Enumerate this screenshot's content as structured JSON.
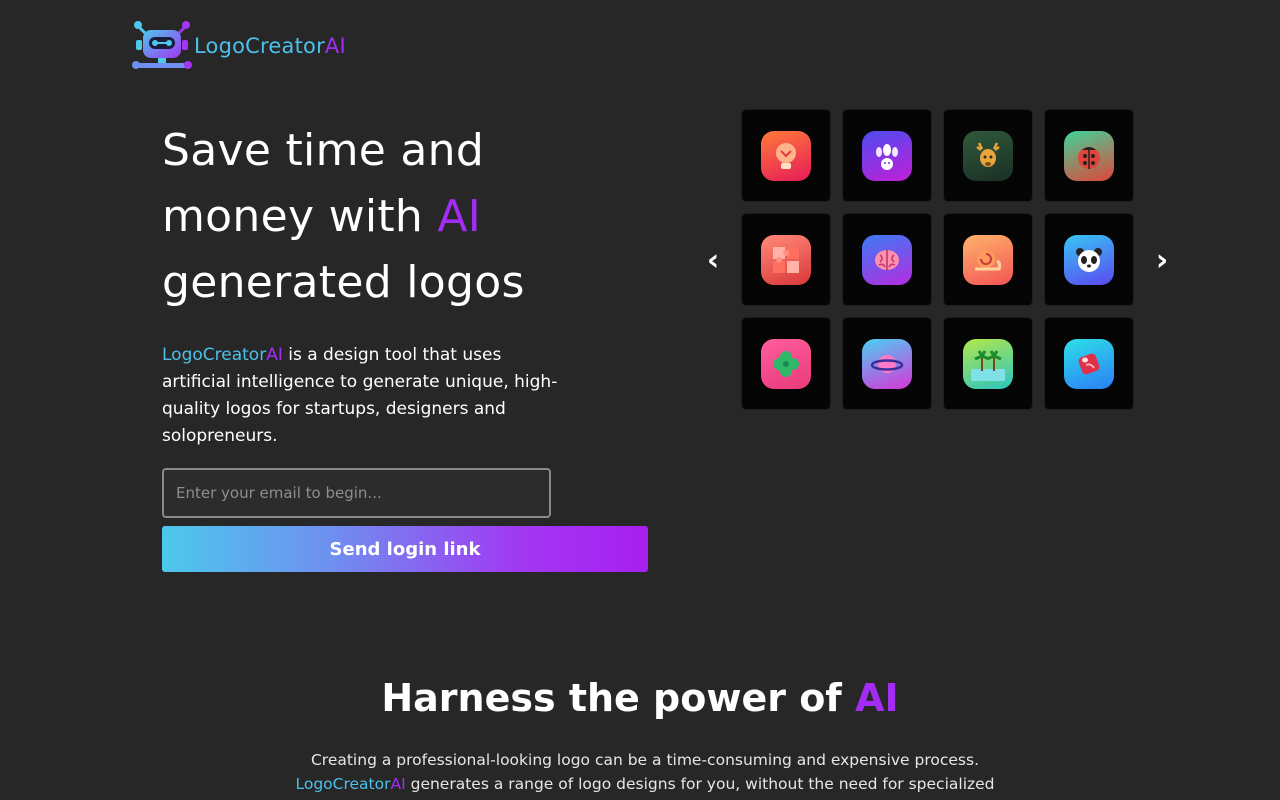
{
  "brand": {
    "name_part1": "LogoCreator",
    "name_part2": "AI",
    "logo_icon": "robot-icon"
  },
  "hero": {
    "title_line1": "Save time and",
    "title_line2_prefix": "money with ",
    "title_line2_highlight": "AI",
    "title_line3": "generated logos",
    "desc_brand1": "LogoCreator",
    "desc_brand2": "AI",
    "desc_text": " is a design tool that uses artificial intelligence to generate unique, high-quality logos for startups, designers and solopreneurs.",
    "email_placeholder": "Enter your email to begin...",
    "email_value": "",
    "cta_label": "Send login link"
  },
  "carousel": {
    "prev_label": "‹",
    "next_label": "›",
    "icons": [
      "lightbulb-icon",
      "bowling-icon",
      "deer-icon",
      "ladybug-icon",
      "puzzle-icon",
      "brain-icon",
      "snail-icon",
      "panda-icon",
      "clover-icon",
      "planet-icon",
      "palm-trees-icon",
      "meat-icon"
    ]
  },
  "section": {
    "title_prefix": "Harness the power of ",
    "title_highlight": "AI",
    "text_line1": "Creating a professional-looking logo can be a time-consuming and expensive process.",
    "text_brand1": "LogoCreator",
    "text_brand2": "AI",
    "text_line2": " generates a range of logo designs for you, without the need for specialized"
  },
  "colors": {
    "background": "#272727",
    "accent_blue": "#4cc0ea",
    "accent_purple": "#a32cf5"
  }
}
